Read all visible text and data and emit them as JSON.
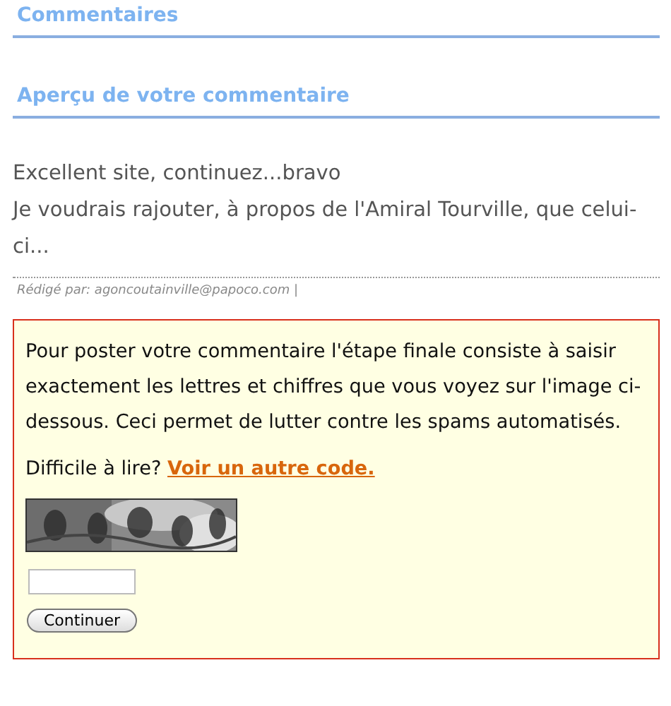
{
  "sections": [
    {
      "title": "Commentaires"
    },
    {
      "title": "Aperçu de votre commentaire"
    }
  ],
  "comment": {
    "lines": [
      "Excellent site, continuez...bravo",
      "Je voudrais rajouter, à propos de l'Amiral Tourville, que celui-ci..."
    ],
    "byline": "Rédigé par: agoncoutainville@papoco.com |"
  },
  "verification": {
    "instructions": "Pour poster votre commentaire l'étape finale consiste à saisir exactement les lettres et chiffres que vous voyez sur l'image ci-dessous. Ceci permet de lutter contre les spams automatisés.",
    "hard_to_read": "Difficile à lire?",
    "link": "Voir un autre code.",
    "button": "Continuer"
  }
}
